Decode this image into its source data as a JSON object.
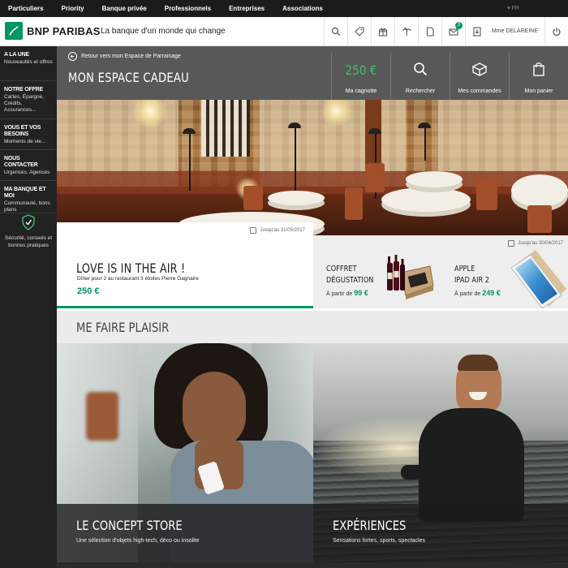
{
  "topnav": {
    "items": [
      "Particuliers",
      "Priority",
      "Banque privée",
      "Professionnels",
      "Entreprises",
      "Associations"
    ],
    "lang": "FR"
  },
  "header": {
    "brand": "BNP PARIBAS",
    "tagline": "La banque d'un monde qui change",
    "user": "Mme DELAREINE",
    "mail_badge": "3",
    "icons": [
      "search-icon",
      "tag-icon",
      "gift-icon",
      "palm-tree-icon",
      "document-icon",
      "mail-icon",
      "download-icon",
      "user-label",
      "power-icon"
    ]
  },
  "sidebar": {
    "items": [
      {
        "title": "A LA UNE",
        "sub": "Nouveautés et offres"
      },
      {
        "title": "NOTRE OFFRE",
        "sub": "Cartes, Épargne, Crédits, Assurances..."
      },
      {
        "title": "VOUS ET VOS BESOINS",
        "sub": "Moments de vie..."
      },
      {
        "title": "NOUS CONTACTER",
        "sub": "Urgences, Agences"
      },
      {
        "title": "MA BANQUE ET MOI",
        "sub": "Communauté, bons plans"
      }
    ],
    "security": "Sécurité, conseils et bonnes pratiques"
  },
  "titleband": {
    "back": "Retour vers mon Espace de Parrainage",
    "title": "MON ESPACE CADEAU",
    "cagnotte_value": "250 €",
    "cagnotte_label": "Ma cagnotte",
    "search_label": "Rechercher",
    "orders_label": "Mes commandes",
    "cart_label": "Mon panier"
  },
  "cards": {
    "main": {
      "date": "Jusqu'au 31/05/2017",
      "title": "LOVE IS IN THE AIR !",
      "desc": "Dîner pour 2 au restaurant 3 étoiles Pierre Gagnaire",
      "price": "250 €"
    },
    "coffret": {
      "title1": "COFFRET",
      "title2": "DÉGUSTATION",
      "from": "À partir de",
      "price": "99 €"
    },
    "ipad": {
      "date": "Jusqu'au 30/04/2017",
      "title1": "APPLE",
      "title2": "IPAD AIR 2",
      "from": "À partir de",
      "price": "249 €"
    }
  },
  "section": {
    "title": "ME FAIRE PLAISIR"
  },
  "tiles": [
    {
      "title": "LE CONCEPT STORE",
      "sub": "Une sélection d'objets high-tech, déco ou insolite"
    },
    {
      "title": "EXPÉRIENCES",
      "sub": "Sensations fortes, sports, spectacles"
    }
  ],
  "colors": {
    "brand_green": "#00965e",
    "price_green": "#3fbf6f",
    "band_gray": "#585858",
    "sidebar": "#222222"
  }
}
